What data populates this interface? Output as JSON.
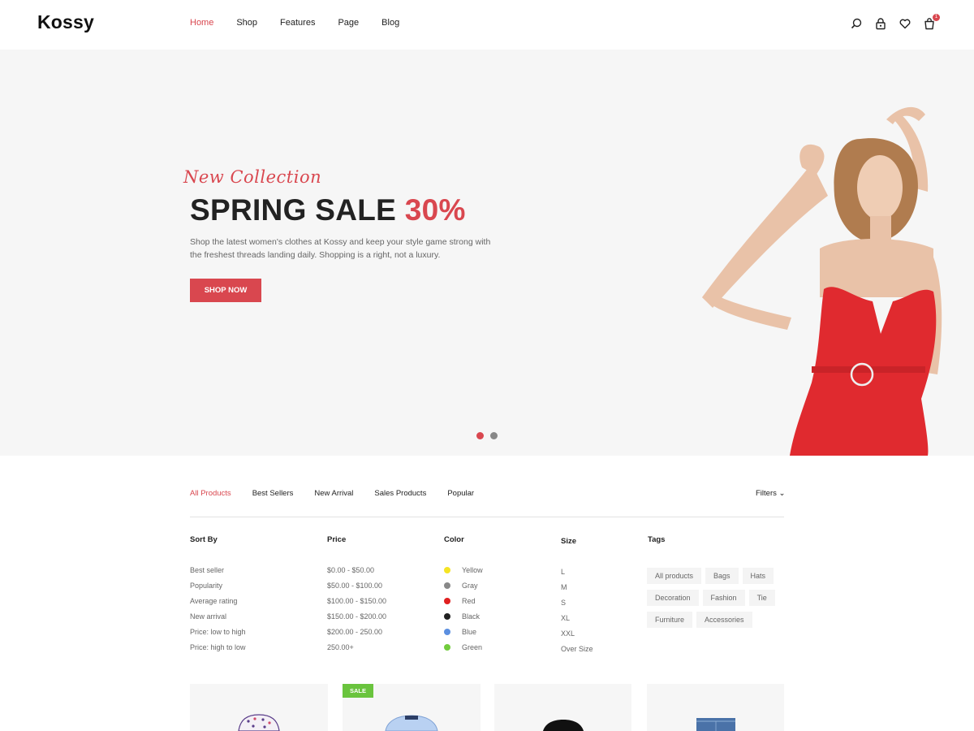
{
  "header": {
    "logo": "Kossy",
    "nav": [
      "Home",
      "Shop",
      "Features",
      "Page",
      "Blog"
    ],
    "active_nav": "Home",
    "icons": [
      "search-icon",
      "lock-icon",
      "heart-icon",
      "cart-icon"
    ],
    "cart_count": "1"
  },
  "hero": {
    "script_text": "New Collection",
    "title_main": "SPRING SALE ",
    "title_accent": "30%",
    "description": "Shop the latest women's clothes at Kossy and keep your style game strong with the freshest threads landing daily. Shopping is a right, not a luxury.",
    "button_label": "SHOP NOW",
    "slides": 2,
    "active_slide": 1
  },
  "tabs": {
    "items": [
      "All Products",
      "Best Sellers",
      "New Arrival",
      "Sales Products",
      "Popular"
    ],
    "active": "All Products",
    "filters_label": "Filters ⌄"
  },
  "filters": {
    "sort_by": {
      "heading": "Sort By",
      "options": [
        "Best seller",
        "Popularity",
        "Average rating",
        "New arrival",
        "Price: low to high",
        "Price: high to low"
      ]
    },
    "price": {
      "heading": "Price",
      "options": [
        "$0.00 - $50.00",
        "$50.00 - $100.00",
        "$100.00 - $150.00",
        "$150.00 - $200.00",
        "$200.00 - 250.00",
        "250.00+"
      ]
    },
    "color": {
      "heading": "Color",
      "options": [
        {
          "label": "Yellow",
          "hex": "#f5e424"
        },
        {
          "label": "Gray",
          "hex": "#888888"
        },
        {
          "label": "Red",
          "hex": "#e02020"
        },
        {
          "label": "Black",
          "hex": "#222222"
        },
        {
          "label": "Blue",
          "hex": "#5b8fe0"
        },
        {
          "label": "Green",
          "hex": "#72cc3d"
        }
      ]
    },
    "size": {
      "heading": "Size",
      "options": [
        "L",
        "M",
        "S",
        "XL",
        "XXL",
        "Over Size"
      ]
    },
    "tags": {
      "heading": "Tags",
      "options": [
        "All products",
        "Bags",
        "Hats",
        "Decoration",
        "Fashion",
        "Tie",
        "Furniture",
        "Accessories"
      ]
    }
  },
  "products": {
    "sale_badge": "SALE"
  },
  "colors": {
    "accent": "#d9474f",
    "hero_bg": "#f6f6f6",
    "sale_green": "#6ac43e"
  }
}
